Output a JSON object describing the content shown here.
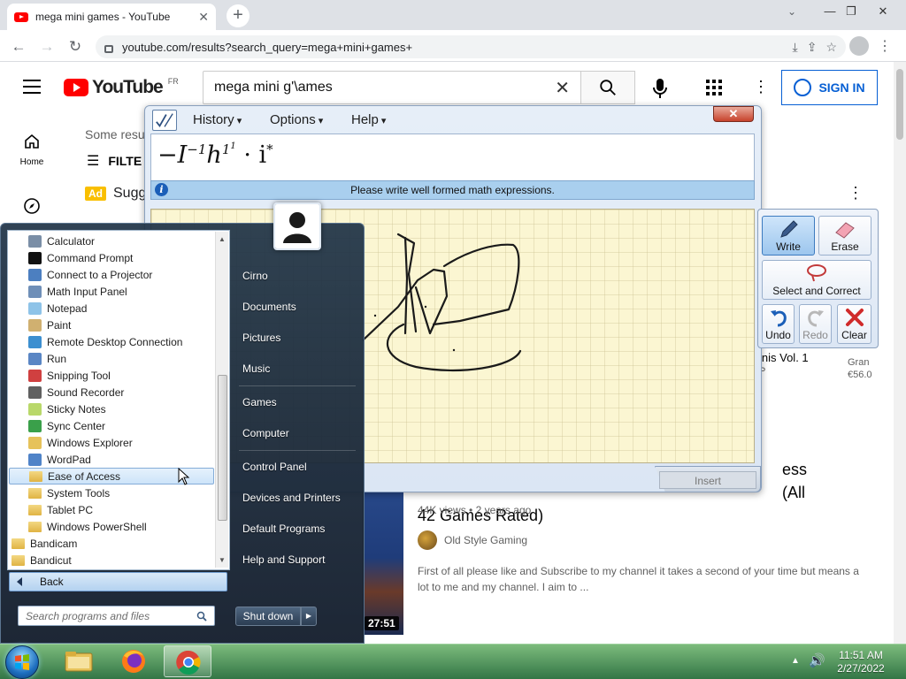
{
  "browser": {
    "tab_title": "mega mini games - YouTube",
    "tab_close": "✕",
    "new_tab": "+",
    "url": "youtube.com/results?search_query=mega+mini+games+",
    "window_minimize": "—",
    "window_restore": "❐",
    "window_close": "✕"
  },
  "youtube": {
    "logo_text": "YouTube",
    "region": "FR",
    "search_value": "mega mini g'\\ames",
    "signin_label": "SIGN IN",
    "sidebar": [
      {
        "label": "Home"
      }
    ],
    "some_results": "Some resu",
    "filters_label": "FILTE",
    "ad_badge": "Ad",
    "ad_title": "Sugg",
    "ad_right_title": "inis Vol. 1",
    "ad_right_sub": "P",
    "ad_right_price_label": "Gran",
    "ad_right_price": "€56.0",
    "video": {
      "title": "Sega Mega Drive Mini Games ... ess (All 42 Games Rated)",
      "title_visible_right": "ess (All",
      "title_line2": "42 Games Rated)",
      "views": "44K views",
      "age": "2 years ago",
      "channel": "Old Style Gaming",
      "description": "First of all please like and Subscribe to my channel it takes a second of your time but means a lot to me and my channel. I aim to ...",
      "duration": "27:51"
    }
  },
  "math_panel": {
    "menu": [
      "History",
      "Options",
      "Help"
    ],
    "status": "Please write well formed math expressions.",
    "tools": {
      "write": "Write",
      "erase": "Erase",
      "select_correct": "Select and Correct",
      "undo": "Undo",
      "redo": "Redo",
      "clear": "Clear"
    },
    "insert": "Insert"
  },
  "start_menu": {
    "programs": [
      {
        "label": "Calculator",
        "icon": "calculator-icon",
        "color": "#7a8ea6"
      },
      {
        "label": "Command Prompt",
        "icon": "cmd-icon",
        "color": "#111111"
      },
      {
        "label": "Connect to a Projector",
        "icon": "projector-icon",
        "color": "#4c7fc0"
      },
      {
        "label": "Math Input Panel",
        "icon": "math-icon",
        "color": "#6f8fb8"
      },
      {
        "label": "Notepad",
        "icon": "notepad-icon",
        "color": "#8ec3e8"
      },
      {
        "label": "Paint",
        "icon": "paint-icon",
        "color": "#d0b070"
      },
      {
        "label": "Remote Desktop Connection",
        "icon": "remote-icon",
        "color": "#3c8fd0"
      },
      {
        "label": "Run",
        "icon": "run-icon",
        "color": "#5a86c4"
      },
      {
        "label": "Snipping Tool",
        "icon": "scissors-icon",
        "color": "#d04040"
      },
      {
        "label": "Sound Recorder",
        "icon": "microphone-icon",
        "color": "#606060"
      },
      {
        "label": "Sticky Notes",
        "icon": "sticky-icon",
        "color": "#b9d86a"
      },
      {
        "label": "Sync Center",
        "icon": "sync-icon",
        "color": "#3aa04a"
      },
      {
        "label": "Windows Explorer",
        "icon": "explorer-icon",
        "color": "#e6c25a"
      },
      {
        "label": "WordPad",
        "icon": "wordpad-icon",
        "color": "#4f83c8"
      }
    ],
    "folders": [
      "Ease of Access",
      "System Tools",
      "Tablet PC",
      "Windows PowerShell"
    ],
    "top_folders": [
      "Bandicam",
      "Bandicut"
    ],
    "back_label": "Back",
    "search_placeholder": "Search programs and files",
    "right_items": [
      "Cirno",
      "Documents",
      "Pictures",
      "Music",
      "Games",
      "Computer",
      "Control Panel",
      "Devices and Printers",
      "Default Programs",
      "Help and Support"
    ],
    "shutdown_label": "Shut down"
  },
  "taskbar": {
    "time": "11:51 AM",
    "date": "2/27/2022"
  }
}
